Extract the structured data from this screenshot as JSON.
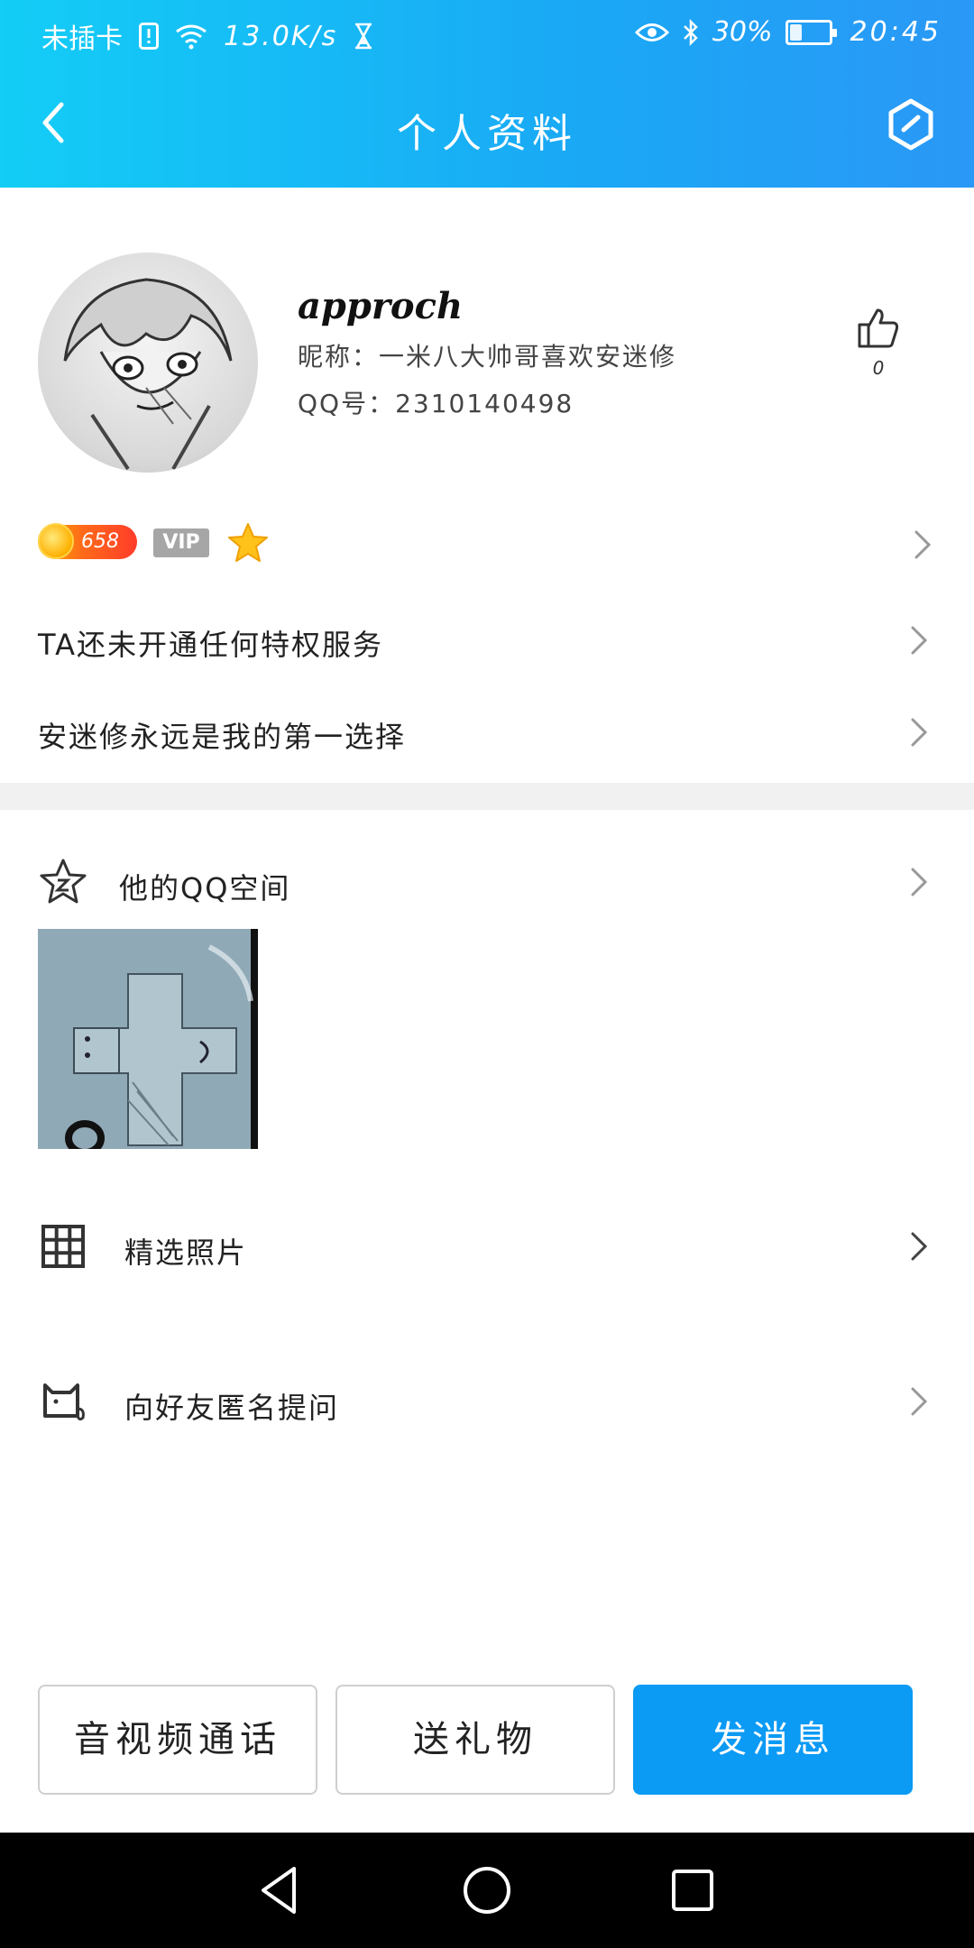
{
  "status_bar": {
    "carrier": "未插卡",
    "net_speed": "13.0K/s",
    "battery_percent": "30%",
    "battery_level": 0.3,
    "time": "20:45",
    "icons": [
      "sim-alert-icon",
      "wifi-icon",
      "hourglass-icon",
      "eye-icon",
      "bluetooth-icon",
      "battery-icon"
    ]
  },
  "nav": {
    "title": "个人资料",
    "back_icon": "chevron-left-icon",
    "action_icon": "hexagon-edit-icon"
  },
  "profile": {
    "username": "approch",
    "nickname": "昵称：一米八大帅哥喜欢安迷修",
    "qq_number": "QQ号：2310140498",
    "like_count": "0"
  },
  "badges": {
    "coin_value": "658",
    "vip_label": "VIP"
  },
  "rows": {
    "privilege_text": "TA还未开通任何特权服务",
    "signature_text": "安迷修永远是我的第一选择"
  },
  "section": {
    "qzone_label": "他的QQ空间",
    "photos_label": "精选照片",
    "ask_label": "向好友匿名提问"
  },
  "actions": {
    "call_label": "音视频通话",
    "gift_label": "送礼物",
    "message_label": "发消息"
  },
  "colors": {
    "header_start": "#13cdf6",
    "header_end": "#2a98f6",
    "primary": "#0b9af4",
    "divider": "#f1f1f1"
  }
}
